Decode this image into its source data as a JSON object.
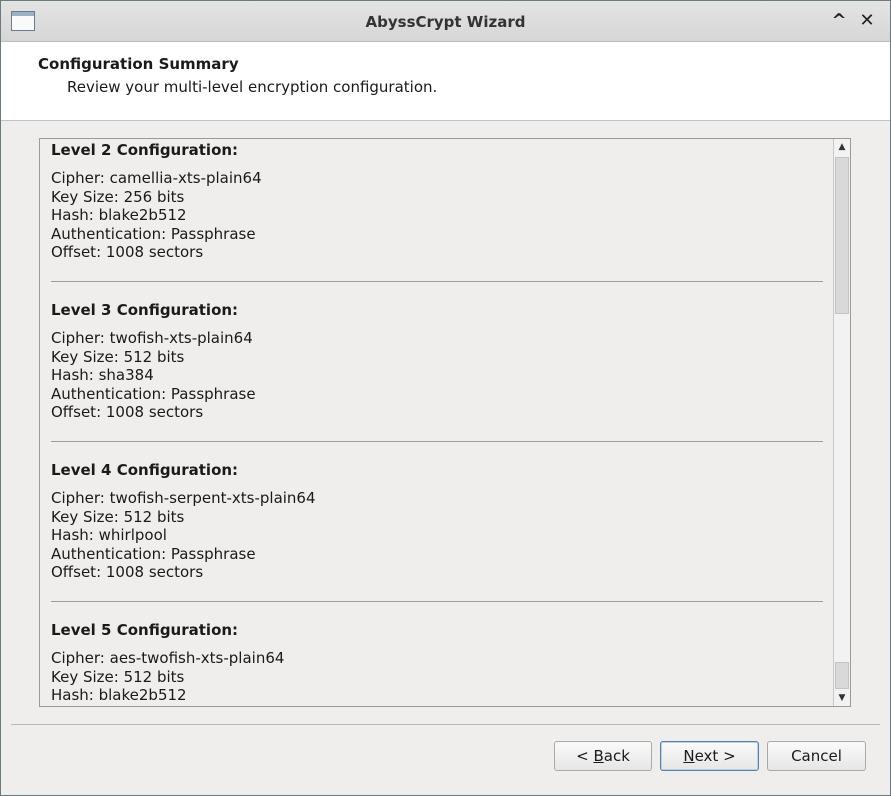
{
  "window": {
    "title": "AbyssCrypt Wizard",
    "icons": {
      "app": "window-icon",
      "maximize": "chevron-up-icon",
      "close": "close-icon"
    },
    "maximize_glyph": "^",
    "close_glyph": "✕"
  },
  "header": {
    "title": "Configuration Summary",
    "subtitle": "Review your multi-level encryption configuration."
  },
  "levels": [
    {
      "title": "Level 2 Configuration:",
      "lines": [
        "Cipher: camellia-xts-plain64",
        "Key Size: 256 bits",
        "Hash: blake2b512",
        "Authentication: Passphrase",
        "Offset: 1008 sectors"
      ]
    },
    {
      "title": "Level 3 Configuration:",
      "lines": [
        "Cipher: twofish-xts-plain64",
        "Key Size: 512 bits",
        "Hash: sha384",
        "Authentication: Passphrase",
        "Offset: 1008 sectors"
      ]
    },
    {
      "title": "Level 4 Configuration:",
      "lines": [
        "Cipher: twofish-serpent-xts-plain64",
        "Key Size: 512 bits",
        "Hash: whirlpool",
        "Authentication: Passphrase",
        "Offset: 1008 sectors"
      ]
    },
    {
      "title": "Level 5 Configuration:",
      "lines": [
        "Cipher: aes-twofish-xts-plain64",
        "Key Size: 512 bits",
        "Hash: blake2b512"
      ]
    }
  ],
  "buttons": {
    "back": {
      "prefix": "< ",
      "mnemonic": "B",
      "rest": "ack"
    },
    "next": {
      "prefix": "",
      "mnemonic": "N",
      "rest": "ext >"
    },
    "cancel": "Cancel"
  }
}
